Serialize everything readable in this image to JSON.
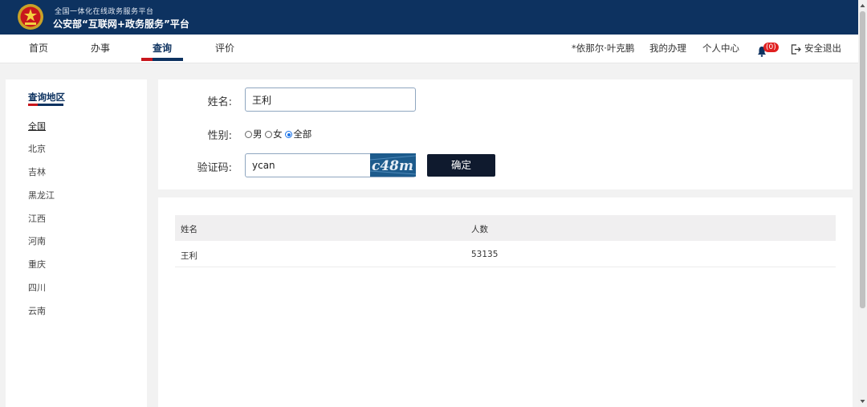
{
  "header": {
    "subtitle": "全国一体化在线政务服务平台",
    "title": "公安部“互联网+政务服务”平台"
  },
  "nav": {
    "items": [
      {
        "label": "首页"
      },
      {
        "label": "办事"
      },
      {
        "label": "查询"
      },
      {
        "label": "评价"
      }
    ],
    "active": "查询",
    "user": "*依那尔·叶克鹏",
    "my_handling": "我的办理",
    "personal_center": "个人中心",
    "notification_count": "(0)",
    "logout": "安全退出"
  },
  "sidebar": {
    "title": "查询地区",
    "items": [
      {
        "label": "全国"
      },
      {
        "label": "北京"
      },
      {
        "label": "吉林"
      },
      {
        "label": "黑龙江"
      },
      {
        "label": "江西"
      },
      {
        "label": "河南"
      },
      {
        "label": "重庆"
      },
      {
        "label": "四川"
      },
      {
        "label": "云南"
      }
    ]
  },
  "form": {
    "name_label": "姓名:",
    "name_value": "王利",
    "gender_label": "性别:",
    "gender_options": [
      "男",
      "女",
      "全部"
    ],
    "gender_selected": "全部",
    "captcha_label": "验证码:",
    "captcha_value": "ycan",
    "captcha_image_text": "c48m",
    "confirm_label": "确定"
  },
  "results": {
    "columns": [
      "姓名",
      "人数"
    ],
    "rows": [
      {
        "name": "王利",
        "count": "53135"
      }
    ]
  },
  "colors": {
    "header_bg": "#0d3260",
    "accent_red": "#c8161d",
    "button_bg": "#0f1a2e",
    "badge_red": "#e02020"
  }
}
